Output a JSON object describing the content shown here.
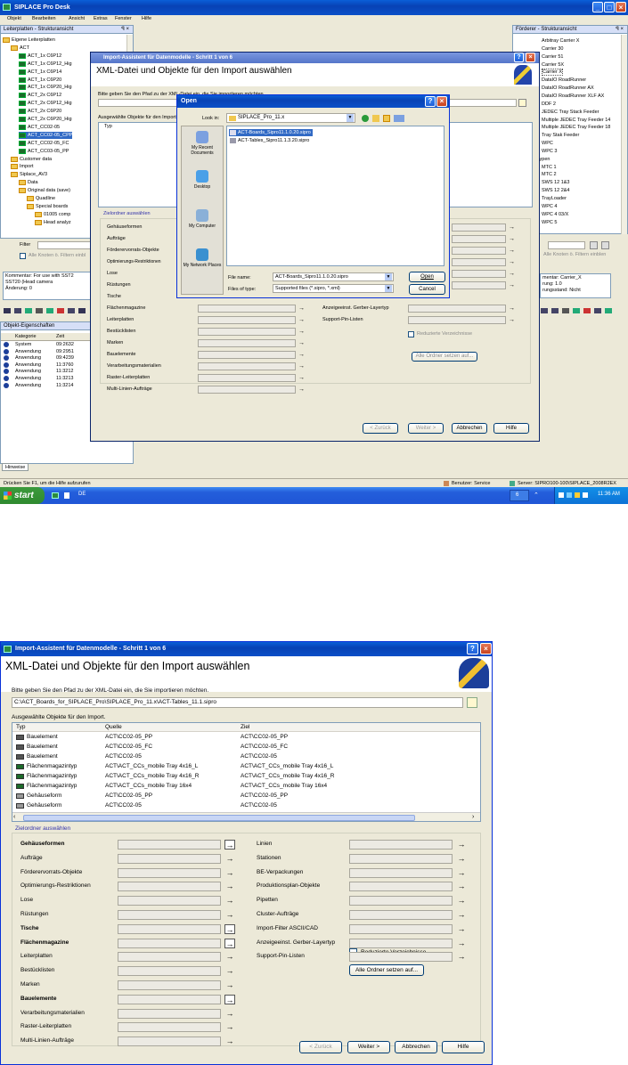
{
  "desktop": {
    "app_title": "SIPLACE Pro Desk",
    "menu": [
      "Objekt",
      "Bearbeiten",
      "Ansicht",
      "Extras",
      "Fenster",
      "Hilfe"
    ],
    "left_panel_title": "Leiterplatten - Strukturansicht",
    "tree": [
      {
        "label": "Eigene Leiterplatten",
        "indent": 0
      },
      {
        "label": "ACT",
        "indent": 1
      },
      {
        "label": "ACT_1x C6P12",
        "indent": 2
      },
      {
        "label": "ACT_1x C6P12_Hig",
        "indent": 2
      },
      {
        "label": "ACT_1x C6P14",
        "indent": 2
      },
      {
        "label": "ACT_1x C6P20",
        "indent": 2
      },
      {
        "label": "ACT_1x C6P20_Hig",
        "indent": 2
      },
      {
        "label": "ACT_2x C6P12",
        "indent": 2
      },
      {
        "label": "ACT_2x C6P12_Hig",
        "indent": 2
      },
      {
        "label": "ACT_2x C6P20",
        "indent": 2
      },
      {
        "label": "ACT_2x C6P20_Hig",
        "indent": 2
      },
      {
        "label": "ACT_CC02-05",
        "indent": 2
      },
      {
        "label": "ACT_CC02-05_CPP",
        "indent": 2
      },
      {
        "label": "ACT_CC02-05_FC",
        "indent": 2
      },
      {
        "label": "ACT_CC03-05_PP",
        "indent": 2
      },
      {
        "label": "Customer data",
        "indent": 1
      },
      {
        "label": "Import",
        "indent": 1
      },
      {
        "label": "Siplace_AV3",
        "indent": 1
      },
      {
        "label": "Data",
        "indent": 2
      },
      {
        "label": "Original data (save)",
        "indent": 2
      },
      {
        "label": "Quadline",
        "indent": 3
      },
      {
        "label": "Special boards",
        "indent": 3
      },
      {
        "label": "01005 comp",
        "indent": 4
      },
      {
        "label": "Head analyz",
        "indent": 4
      }
    ],
    "filter_label": "Filter",
    "filter_note": "Alle Knoten ö. Filtern einbl",
    "comment_text": "Kommentar: For use with SST2\nSST20 (Head camera\nÄnderung: 0",
    "props_title": "Objekt-Eigenschaften",
    "log_headers": [
      "Kategorie",
      "Zeit"
    ],
    "log_rows": [
      [
        "System",
        "09:2632"
      ],
      [
        "Anwendung",
        "09:2951"
      ],
      [
        "Anwendung",
        "09:4239"
      ],
      [
        "Anwendung",
        "11:3760"
      ],
      [
        "Anwendung",
        "11:3212"
      ],
      [
        "Anwendung",
        "11:3213"
      ],
      [
        "Anwendung",
        "11:3214"
      ]
    ],
    "hints_tab": "Hinweise",
    "status_left": "Drücken Sie F1, um die Hilfe aufzurufen",
    "status_user": "Benutzer: Service",
    "status_server": "Server: SIPRO100-100\\SIPLACE_2008R2EX",
    "right_panel_title": "Förderer - Strukturansicht",
    "right_items": [
      "Arbitray Carrier X",
      "Carrier 30",
      "Carrier 51",
      "Carrier 5X",
      "Carrier X",
      "DataIO RoadRunner",
      "DataIO RoadRunner AX",
      "DataIO RoadRunner XLF AX",
      "DDF 2",
      "JEDEC Tray Stack Feeder",
      "Multiple JEDEC Tray Feeder 14",
      "Multiple JEDEC Tray Feeder 18",
      "Tray Stak Feeder",
      "WPC",
      "WPC 3",
      "ene MTC-Typen",
      "MTC 1",
      "MTC 2",
      "SWS 12 1&3",
      "SWS 12 2&4",
      "TrayLoader",
      "WPC 4",
      "WPC 4 03/X",
      "WPC 5"
    ],
    "right_filter_note": "Alle Knoten ö. Filtern einblen",
    "right_comment": "mentar: Carrier_X\nrung: 1.0\nrungsstand: Nicht",
    "taskbar_start": "start",
    "taskbar_lang": "DE",
    "tray_time": "11:36 AM",
    "tray_num": "6"
  },
  "wizard_top": {
    "title": "Import-Assistent für Datenmodelle - Schritt 1 von 6",
    "heading": "XML-Datei und Objekte für den Import auswählen",
    "path_prompt": "Bitte geben Sie den Pfad zu der XML-Datei ein, die Sie importieren möchten.",
    "selected_objects": "Ausgewählte Objekte für den Import.",
    "col_typ": "Typ",
    "target_folder": "Zielordner auswählen",
    "left_labels": [
      "Gehäuseformen",
      "Aufträge",
      "Förderervorrats-Objekte",
      "Optimierungs-Restriktionen",
      "Lose",
      "Rüstungen",
      "Tische",
      "Flächenmagazine",
      "Leiterplatten",
      "Bestücklisten",
      "Marken",
      "Bauelemente",
      "Verarbeitungsmaterialien",
      "Raster-Leiterplatten",
      "Multi-Linien-Aufträge"
    ],
    "right_labels_visible": [
      "Anzeigeeinst. Gerber-Layertyp",
      "Support-Pin-Listen"
    ],
    "reduced_dirs": "Reduzierte Verzeichnisse",
    "set_all": "Alle Ordner setzen auf...",
    "btn_back": "< Zurück",
    "btn_next": "Weiter >",
    "btn_cancel": "Abbrechen",
    "btn_help": "Hilfe"
  },
  "open_dialog": {
    "title": "Open",
    "look_in_label": "Look in:",
    "look_in_value": "SIPLACE_Pro_11.x",
    "files": [
      "ACT-Boards_Sipro11.1.0.20.sipro",
      "ACT-Tables_Sipro11.1.3.20.sipro"
    ],
    "places": [
      "My Recent Documents",
      "Desktop",
      "My Computer",
      "My Network Places"
    ],
    "file_name_label": "File name:",
    "file_name_value": "ACT-Boards_Sipro11.1.0.20.sipro",
    "file_type_label": "Files of type:",
    "file_type_value": "Supported files (*.sipro, *.xml)",
    "btn_open": "Open",
    "btn_cancel": "Cancel"
  },
  "wizard_bottom": {
    "title": "Import-Assistent für Datenmodelle - Schritt 1 von 6",
    "heading": "XML-Datei und Objekte für den Import auswählen",
    "path_prompt": "Bitte geben Sie den Pfad zu der XML-Datei ein, die Sie importieren möchten.",
    "path_value": "C:\\ACT_Boards_for_SIPLACE_Pro\\SIPLACE_Pro_11.x\\ACT-Tables_11.1.sipro",
    "selected_objects": "Ausgewählte Objekte für den Import.",
    "columns": [
      "Typ",
      "Quelle",
      "Ziel"
    ],
    "rows": [
      [
        "Bauelement",
        "ACT\\CC02-05_PP",
        "ACT\\CC02-05_PP"
      ],
      [
        "Bauelement",
        "ACT\\CC02-05_FC",
        "ACT\\CC02-05_FC"
      ],
      [
        "Bauelement",
        "ACT\\CC02-05",
        "ACT\\CC02-05"
      ],
      [
        "Flächenmagazintyp",
        "ACT\\ACT_CCs_mobile Tray 4x16_L",
        "ACT\\ACT_CCs_mobile Tray 4x16_L"
      ],
      [
        "Flächenmagazintyp",
        "ACT\\ACT_CCs_mobile Tray 4x16_R",
        "ACT\\ACT_CCs_mobile Tray 4x16_R"
      ],
      [
        "Flächenmagazintyp",
        "ACT\\ACT_CCs_mobile Tray 16x4",
        "ACT\\ACT_CCs_mobile Tray 16x4"
      ],
      [
        "Gehäuseform",
        "ACT\\CC02-05_PP",
        "ACT\\CC02-05_PP"
      ],
      [
        "Gehäuseform",
        "ACT\\CC02-05",
        "ACT\\CC02-05"
      ]
    ],
    "target_folder": "Zielordner auswählen",
    "left_labels": [
      {
        "label": "Gehäuseformen",
        "bold": true
      },
      {
        "label": "Aufträge",
        "bold": false
      },
      {
        "label": "Förderervorrats-Objekte",
        "bold": false
      },
      {
        "label": "Optimierungs-Restriktionen",
        "bold": false
      },
      {
        "label": "Lose",
        "bold": false
      },
      {
        "label": "Rüstungen",
        "bold": false
      },
      {
        "label": "Tische",
        "bold": true
      },
      {
        "label": "Flächenmagazine",
        "bold": true
      },
      {
        "label": "Leiterplatten",
        "bold": false
      },
      {
        "label": "Bestücklisten",
        "bold": false
      },
      {
        "label": "Marken",
        "bold": false
      },
      {
        "label": "Bauelemente",
        "bold": true
      },
      {
        "label": "Verarbeitungsmaterialien",
        "bold": false
      },
      {
        "label": "Raster-Leiterplatten",
        "bold": false
      },
      {
        "label": "Multi-Linien-Aufträge",
        "bold": false
      }
    ],
    "right_labels": [
      "Linien",
      "Stationen",
      "BE-Verpackungen",
      "Produktionsplan-Objekte",
      "Pipetten",
      "Cluster-Aufträge",
      "Import-Filter ASCII/CAD",
      "Anzeigeeinst. Gerber-Layertyp",
      "Support-Pin-Listen"
    ],
    "reduced_dirs": "Reduzierte Verzeichnisse",
    "set_all": "Alle Ordner setzen auf...",
    "btn_back": "< Zurück",
    "btn_next": "Weiter >",
    "btn_cancel": "Abbrechen",
    "btn_help": "Hilfe"
  }
}
